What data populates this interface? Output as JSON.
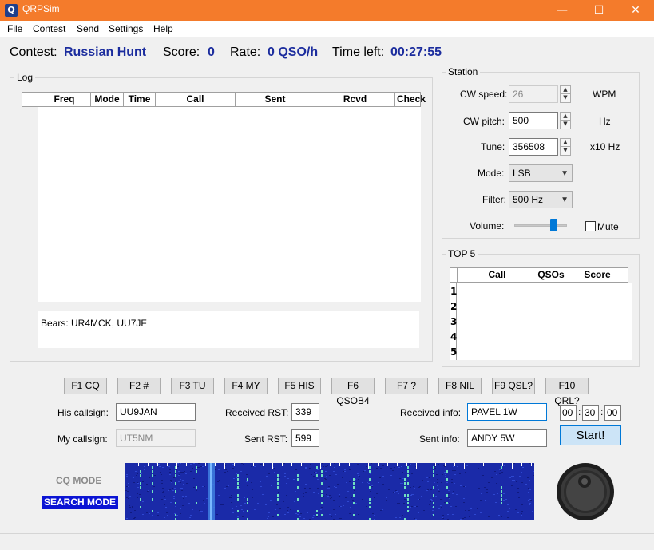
{
  "window": {
    "title": "QRPSim",
    "icon": "qrpsim-app-icon",
    "minimize": "—",
    "maximize": "☐",
    "close": "✕"
  },
  "menu": [
    "File",
    "Contest",
    "Send",
    "Settings",
    "Help"
  ],
  "header": {
    "contest_label": "Contest:",
    "contest_value": "Russian Hunt",
    "score_label": "Score:",
    "score_value": "0",
    "rate_label": "Rate:",
    "rate_value": "0 QSO/h",
    "time_label": "Time left:",
    "time_value": "00:27:55"
  },
  "log": {
    "title": "Log",
    "columns": [
      "Freq",
      "Mode",
      "Time",
      "Call",
      "Sent",
      "Rcvd",
      "Check"
    ],
    "bears_text": "Bears: UR4MCK, UU7JF"
  },
  "station": {
    "title": "Station",
    "cw_speed_label": "CW speed:",
    "cw_speed_value": "26",
    "cw_speed_unit": "WPM",
    "cw_pitch_label": "CW pitch:",
    "cw_pitch_value": "500",
    "cw_pitch_unit": "Hz",
    "tune_label": "Tune:",
    "tune_value": "356508",
    "tune_unit": "x10 Hz",
    "mode_label": "Mode:",
    "mode_value": "LSB",
    "filter_label": "Filter:",
    "filter_value": "500 Hz",
    "volume_label": "Volume:",
    "volume_level": 0.78,
    "mute_label": "Mute"
  },
  "top5": {
    "title": "TOP 5",
    "columns": [
      "Call",
      "QSOs",
      "Score"
    ],
    "rows": [
      "1",
      "2",
      "3",
      "4",
      "5"
    ]
  },
  "fkeys": [
    "F1 CQ",
    "F2 #",
    "F3 TU",
    "F4 MY",
    "F5 HIS",
    "F6 QSOB4",
    "F7 ?",
    "F8 NIL",
    "F9 QSL?",
    "F10 QRL?"
  ],
  "entry": {
    "his_callsign_label": "His callsign:",
    "his_callsign_value": "UU9JAN",
    "my_callsign_label": "My callsign:",
    "my_callsign_value": "UT5NM",
    "received_rst_label": "Received RST:",
    "received_rst_value": "339",
    "sent_rst_label": "Sent RST:",
    "sent_rst_value": "599",
    "received_info_label": "Received info:",
    "received_info_value": "PAVEL 1W",
    "sent_info_label": "Sent info:",
    "sent_info_value": "ANDY 5W",
    "timer_h": "00",
    "timer_m": "30",
    "timer_s": "00",
    "start_label": "Start!"
  },
  "modes": {
    "cq": "CQ MODE",
    "search": "SEARCH MODE"
  },
  "colors": {
    "accent_blue": "#1c2d9e",
    "titlebar": "#f47b2b",
    "waterfall_bg": "#1a2aa8",
    "search_mode_bg": "#0b14d4"
  }
}
